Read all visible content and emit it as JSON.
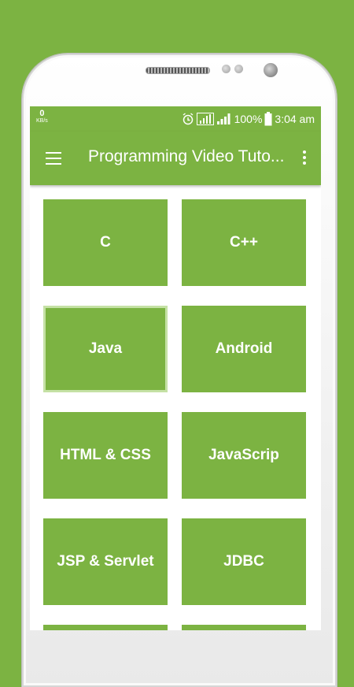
{
  "status_bar": {
    "net_speed": "0",
    "net_unit": "KB/s",
    "battery": "100%",
    "time": "3:04 am"
  },
  "toolbar": {
    "title": "Programming Video Tuto..."
  },
  "tiles": [
    {
      "label": "C"
    },
    {
      "label": "C++"
    },
    {
      "label": "Java"
    },
    {
      "label": "Android"
    },
    {
      "label": "HTML & CSS"
    },
    {
      "label": "JavaScrip"
    },
    {
      "label": "JSP & Servlet"
    },
    {
      "label": "JDBC"
    },
    {
      "label": ""
    },
    {
      "label": ""
    }
  ],
  "colors": {
    "primary": "#7cb342",
    "focus_border": "#c5e1a5",
    "screen_bg": "#ffffff"
  }
}
